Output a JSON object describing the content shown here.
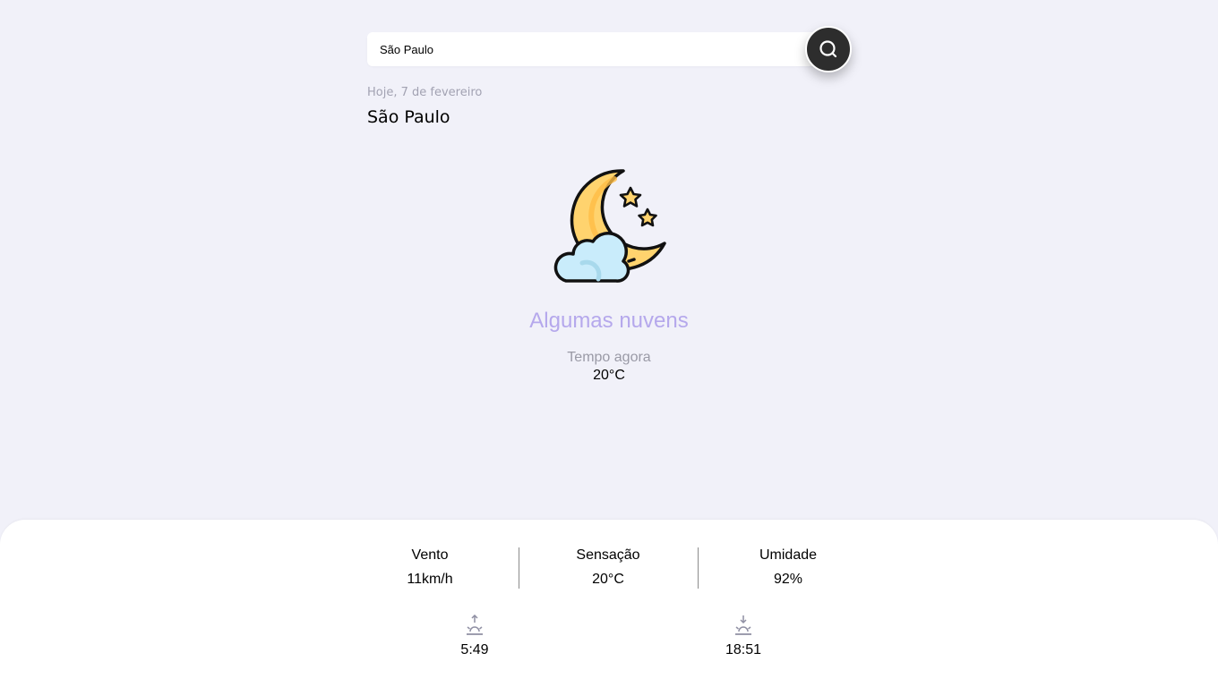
{
  "search": {
    "value": "São Paulo",
    "button_icon": "search-icon"
  },
  "header": {
    "date": "Hoje, 7 de fevereiro",
    "city": "São Paulo"
  },
  "current": {
    "icon": "moon-stars-cloud-icon",
    "description": "Algumas nuvens",
    "now_label": "Tempo agora",
    "temperature": "20°C"
  },
  "details": {
    "wind": {
      "label": "Vento",
      "value": "11km/h"
    },
    "feels_like": {
      "label": "Sensação",
      "value": "20°C"
    },
    "humidity": {
      "label": "Umidade",
      "value": "92%"
    },
    "sunrise": {
      "icon": "sunrise-icon",
      "time": "5:49"
    },
    "sunset": {
      "icon": "sunset-icon",
      "time": "18:51"
    }
  },
  "colors": {
    "background": "#f1f1f9",
    "accent": "#b5a8ec",
    "button": "#2d2d2d",
    "panel": "#ffffff"
  }
}
